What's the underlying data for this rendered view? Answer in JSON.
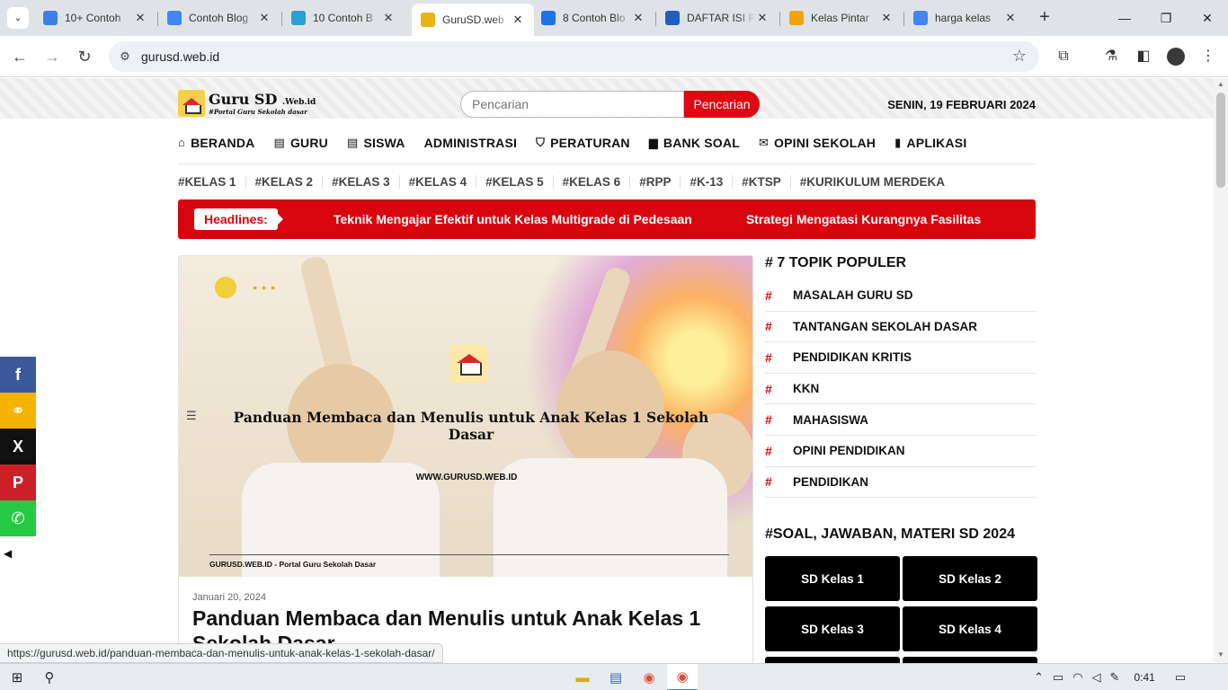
{
  "browser": {
    "tabs": [
      {
        "title": "10+ Contoh",
        "favicon": "docs-icon",
        "color": "#3f7ee8"
      },
      {
        "title": "Contoh Blog",
        "favicon": "google-icon",
        "color": "#4285f4"
      },
      {
        "title": "10 Contoh B",
        "favicon": "telegram-icon",
        "color": "#2a9fd6"
      },
      {
        "title": "GuruSD.web",
        "favicon": "gurusd-icon",
        "color": "#e7b416",
        "active": true
      },
      {
        "title": "8 Contoh Blo",
        "favicon": "location-icon",
        "color": "#1a73e8"
      },
      {
        "title": "DAFTAR ISI P",
        "favicon": "ig-icon",
        "color": "#1f5fbf"
      },
      {
        "title": "Kelas Pintar",
        "favicon": "kelaspintar-icon",
        "color": "#f2a500"
      },
      {
        "title": "harga kelas",
        "favicon": "google-icon",
        "color": "#4285f4"
      }
    ],
    "url": "gurusd.web.id",
    "status_url": "https://gurusd.web.id/panduan-membaca-dan-menulis-untuk-anak-kelas-1-sekolah-dasar/"
  },
  "site": {
    "logo_name": "Guru SD",
    "logo_suffix": ".Web.id",
    "logo_tagline": "#Portal Guru Sekolah dasar",
    "search_placeholder": "Pencarian",
    "search_button": "Pencarian",
    "date": "SENIN, 19 FEBRUARI 2024",
    "nav": [
      {
        "label": "BERANDA",
        "icon": "home-icon"
      },
      {
        "label": "GURU",
        "icon": "list-icon"
      },
      {
        "label": "SISWA",
        "icon": "list-icon"
      },
      {
        "label": "ADMINISTRASI",
        "icon": ""
      },
      {
        "label": "PERATURAN",
        "icon": "shield-icon"
      },
      {
        "label": "BANK SOAL",
        "icon": "folder-icon"
      },
      {
        "label": "OPINI SEKOLAH",
        "icon": "chat-icon"
      },
      {
        "label": "APLIKASI",
        "icon": "mobile-icon"
      }
    ],
    "tags": [
      "#KELAS 1",
      "#KELAS 2",
      "#KELAS 3",
      "#KELAS 4",
      "#KELAS 5",
      "#KELAS 6",
      "#RPP",
      "#K-13",
      "#KTSP",
      "#KURIKULUM MERDEKA"
    ],
    "headlines_label": "Headlines:",
    "headlines": [
      "Teknik Mengajar Efektif untuk Kelas Multigrade di Pedesaan",
      "Strategi Mengatasi Kurangnya Fasilitas"
    ]
  },
  "article": {
    "image_title": "Panduan Membaca dan Menulis untuk Anak Kelas 1 Sekolah Dasar",
    "image_url": "WWW.GURUSD.WEB.ID",
    "image_footer": "GURUSD.WEB.ID - Portal Guru Sekolah Dasar",
    "date": "Januari 20, 2024",
    "title": "Panduan Membaca dan Menulis untuk Anak Kelas 1 Sekolah Dasar"
  },
  "sidebar": {
    "topics_title": "# 7 TOPIK POPULER",
    "topics": [
      "MASALAH GURU SD",
      "TANTANGAN SEKOLAH DASAR",
      "PENDIDIKAN KRITIS",
      "KKN",
      "MAHASISWA",
      "OPINI PENDIDIKAN",
      "PENDIDIKAN"
    ],
    "soal_title": "#SOAL, JAWABAN, MATERI SD 2024",
    "soal_buttons": [
      "SD Kelas 1",
      "SD Kelas 2",
      "SD Kelas 3",
      "SD Kelas 4",
      "",
      ""
    ]
  },
  "share": [
    {
      "name": "facebook",
      "glyph": "f",
      "color": "#3b5998"
    },
    {
      "name": "copy-link",
      "glyph": "⚭",
      "color": "#f5b400"
    },
    {
      "name": "x",
      "glyph": "X",
      "color": "#111111"
    },
    {
      "name": "pinterest",
      "glyph": "P",
      "color": "#cb2027"
    },
    {
      "name": "whatsapp",
      "glyph": "✆",
      "color": "#26c943"
    }
  ],
  "taskbar": {
    "time": "0:41"
  }
}
